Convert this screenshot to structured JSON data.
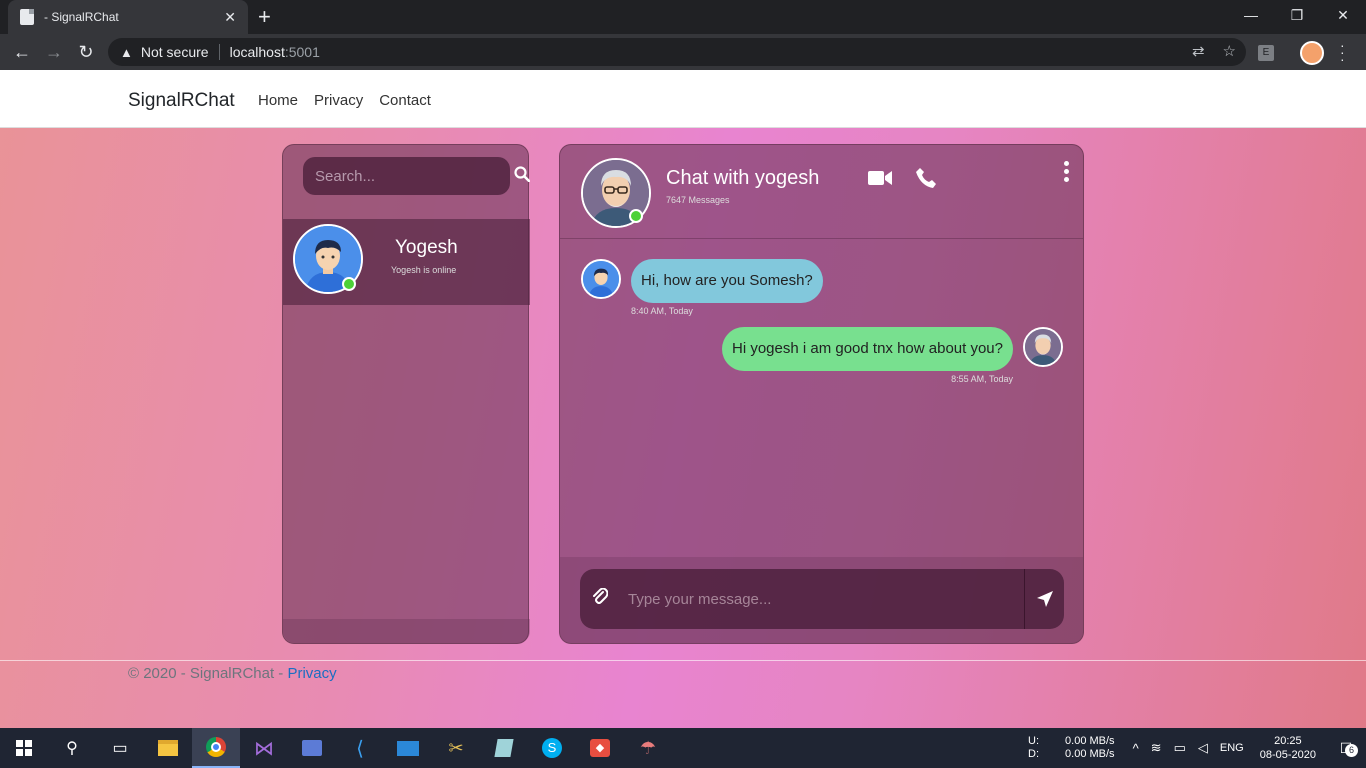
{
  "browser": {
    "tab_title": "- SignalRChat",
    "new_tab": "+",
    "security_label": "Not secure",
    "url_host": "localhost",
    "url_port": ":5001",
    "ext_label": "E"
  },
  "navbar": {
    "brand": "SignalRChat",
    "links": [
      "Home",
      "Privacy",
      "Contact"
    ]
  },
  "sidebar": {
    "search_placeholder": "Search...",
    "contact": {
      "name": "Yogesh",
      "status": "Yogesh is online"
    }
  },
  "chat": {
    "title": "Chat with yogesh",
    "count": "7647 Messages",
    "messages": [
      {
        "text": "Hi, how are you Somesh?",
        "time": "8:40 AM, Today",
        "direction": "incoming"
      },
      {
        "text": "Hi yogesh i am good tnx how about you?",
        "time": "8:55 AM, Today",
        "direction": "outgoing"
      }
    ],
    "composer_placeholder": "Type your message..."
  },
  "footer": {
    "copyright": "© 2020 - SignalRChat - ",
    "privacy_link": "Privacy"
  },
  "taskbar": {
    "net_up_label": "U:",
    "net_down_label": "D:",
    "net_up": "0.00 MB/s",
    "net_down": "0.00 MB/s",
    "lang": "ENG",
    "time": "20:25",
    "date": "08-05-2020",
    "notifications": "6"
  },
  "colors": {
    "online": "#4cd137",
    "incoming_bubble": "#82c8dc",
    "outgoing_bubble": "#78e08f",
    "link": "#1b6ec2"
  }
}
